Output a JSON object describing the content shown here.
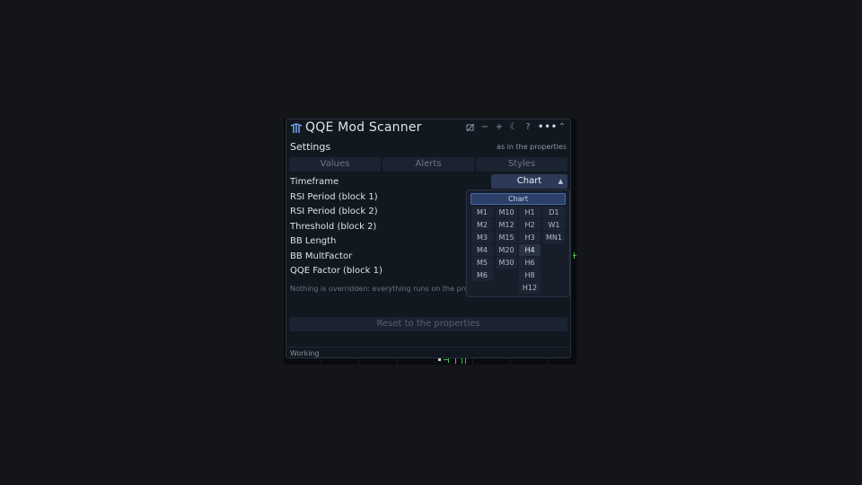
{
  "window": {
    "title": "QQE Mod Scanner"
  },
  "titlebar_icons": [
    "hide-icon",
    "minus-icon",
    "plus-icon",
    "moon-icon",
    "help-icon",
    "more-icon",
    "collapse-icon"
  ],
  "titlebar_glyphs": {
    "minus": "−",
    "plus": "+",
    "moon": "☾",
    "help": "?",
    "more": "•••",
    "collapse": "⌃"
  },
  "settings": {
    "header": "Settings",
    "note": "as in the properties"
  },
  "tabs": [
    "Values",
    "Alerts",
    "Styles"
  ],
  "rows": [
    "Timeframe",
    "RSI Period (block 1)",
    "RSI Period (block 2)",
    "Threshold (block 2)",
    "BB Length",
    "BB MultFactor",
    "QQE Factor (block 1)"
  ],
  "timeframe": {
    "value": "Chart",
    "caret": "▲"
  },
  "override_note": "Nothing is overridden: everything runs on the properties",
  "reset_label": "Reset to the properties",
  "status": "Working",
  "dropdown": {
    "chart_label": "Chart",
    "selected": "H4",
    "col1": [
      "M1",
      "M2",
      "M3",
      "M4",
      "M5",
      "M6"
    ],
    "col2": [
      "M10",
      "M12",
      "M15",
      "M20",
      "M30"
    ],
    "col3": [
      "H1",
      "H2",
      "H3",
      "H4",
      "H6",
      "H8",
      "H12"
    ],
    "col4": [
      "D1",
      "W1",
      "MN1"
    ]
  },
  "colors": {
    "accent": "#2c3a58",
    "panel": "#121820",
    "selected_chart": "#2c3f66"
  }
}
